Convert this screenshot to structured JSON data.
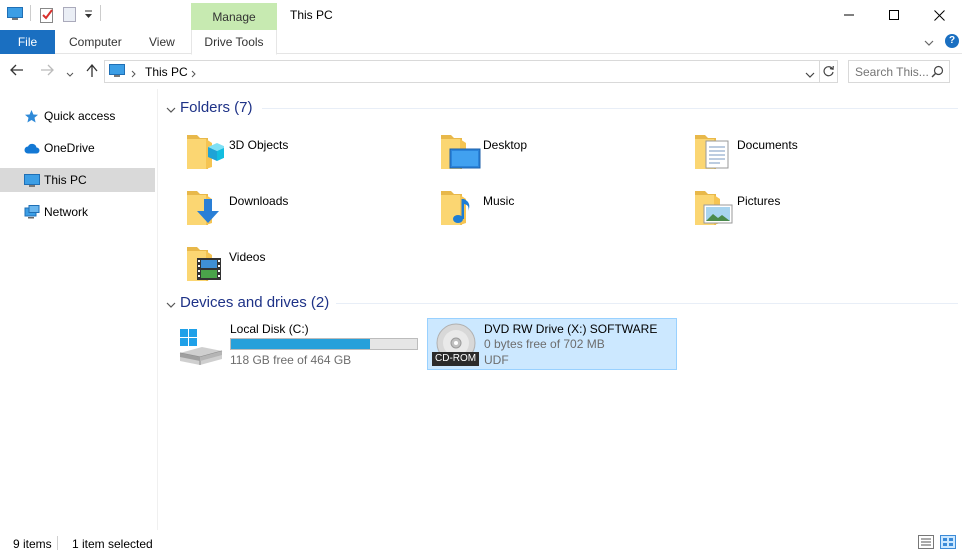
{
  "titlebar": {
    "manage_label": "Manage",
    "window_title": "This PC"
  },
  "ribbon": {
    "file_label": "File",
    "computer_label": "Computer",
    "view_label": "View",
    "drive_tools_label": "Drive Tools",
    "help_glyph": "?"
  },
  "address": {
    "path": [
      "This PC"
    ],
    "current": "This PC"
  },
  "search": {
    "placeholder": "Search This..."
  },
  "sidebar": {
    "items": [
      {
        "label": "Quick access",
        "icon": "star-icon"
      },
      {
        "label": "OneDrive",
        "icon": "cloud-icon"
      },
      {
        "label": "This PC",
        "icon": "computer-icon",
        "selected": true
      },
      {
        "label": "Network",
        "icon": "network-icon"
      }
    ]
  },
  "folders": {
    "header": "Folders (7)",
    "items": [
      {
        "name": "3D Objects",
        "icon": "3d-objects-folder-icon"
      },
      {
        "name": "Desktop",
        "icon": "desktop-folder-icon"
      },
      {
        "name": "Documents",
        "icon": "documents-folder-icon"
      },
      {
        "name": "Downloads",
        "icon": "downloads-folder-icon"
      },
      {
        "name": "Music",
        "icon": "music-folder-icon"
      },
      {
        "name": "Pictures",
        "icon": "pictures-folder-icon"
      },
      {
        "name": "Videos",
        "icon": "videos-folder-icon"
      }
    ]
  },
  "devices": {
    "header": "Devices and drives (2)",
    "drives": [
      {
        "name": "Local Disk (C:)",
        "free_text": "118 GB free of 464 GB",
        "used_fraction": 0.746,
        "icon": "hard-drive-icon"
      },
      {
        "name": "DVD RW Drive (X:) SOFTWARE",
        "free_text": "0 bytes free of 702 MB",
        "filesystem": "UDF",
        "badge": "CD-ROM",
        "icon": "dvd-drive-icon",
        "selected": true
      }
    ]
  },
  "status": {
    "item_count": "9 items",
    "selection": "1 item selected"
  },
  "colors": {
    "accent": "#1a6fc1",
    "manage_tab": "#c7eab1",
    "selection": "#cce8ff",
    "capacity_fill": "#26a0da",
    "group_header_text": "#1e3287"
  }
}
